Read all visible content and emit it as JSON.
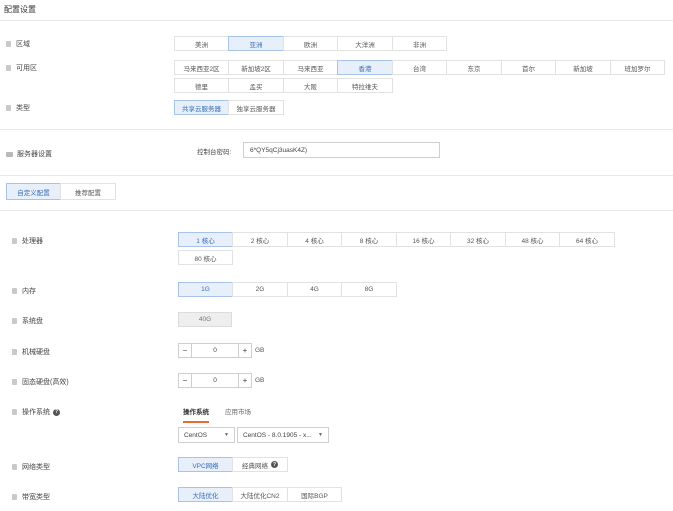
{
  "page": {
    "title": "配置设置"
  },
  "region": {
    "label": "区域",
    "options": [
      "美洲",
      "亚洲",
      "欧洲",
      "大洋洲",
      "非洲"
    ],
    "selected": "亚洲"
  },
  "zone": {
    "label": "可用区",
    "row1": [
      "马来西亚2区",
      "新加坡2区",
      "马来西亚",
      "香港",
      "台湾",
      "东京",
      "首尔",
      "新加坡",
      "班加罗尔"
    ],
    "row2": [
      "德里",
      "孟买",
      "大阪",
      "特拉维夫"
    ],
    "selected": "香港"
  },
  "type": {
    "label": "类型",
    "options": [
      "共享云服务器",
      "独享云服务器"
    ],
    "selected": "共享云服务器"
  },
  "server": {
    "label": "服务器设置",
    "password_label": "控制台密码:",
    "password_value": "6*QY5qCj3uasK4Z)"
  },
  "config_tabs": {
    "options": [
      "自定义配置",
      "推荐配置"
    ],
    "selected": "自定义配置"
  },
  "cpu": {
    "label": "处理器",
    "row1": [
      "1 核心",
      "2 核心",
      "4 核心",
      "8 核心",
      "16 核心",
      "32 核心",
      "48 核心",
      "64 核心"
    ],
    "row2": [
      "80 核心"
    ],
    "selected": "1 核心"
  },
  "memory": {
    "label": "内存",
    "options": [
      "1G",
      "2G",
      "4G",
      "8G"
    ],
    "selected": "1G"
  },
  "system_disk": {
    "label": "系统盘",
    "value": "40G"
  },
  "hdd": {
    "label": "机械硬盘",
    "minus": "−",
    "value": "0",
    "plus": "+",
    "unit": "GB"
  },
  "ssd": {
    "label": "固态硬盘(高效)",
    "minus": "−",
    "value": "0",
    "plus": "+",
    "unit": "GB"
  },
  "os": {
    "label": "操作系统",
    "help": "?",
    "tabs": [
      "操作系统",
      "应用市场"
    ],
    "active_tab": "操作系统",
    "distro": "CentOS",
    "version": "CentOS - 8.0.1905 - x...",
    "caret": "▼"
  },
  "network": {
    "label": "网络类型",
    "options": [
      "VPC网络",
      "经典网络"
    ],
    "selected": "VPC网络",
    "help": "?"
  },
  "bandwidth": {
    "label": "带宽类型",
    "options": [
      "大陆优化",
      "大陆优化CN2",
      "国际BGP"
    ],
    "selected": "大陆优化"
  },
  "colors": {
    "selected_bg": "#e7effb",
    "selected_border": "#a8c3ea",
    "selected_text": "#3a6db5",
    "tab_accent": "#e86b35"
  }
}
